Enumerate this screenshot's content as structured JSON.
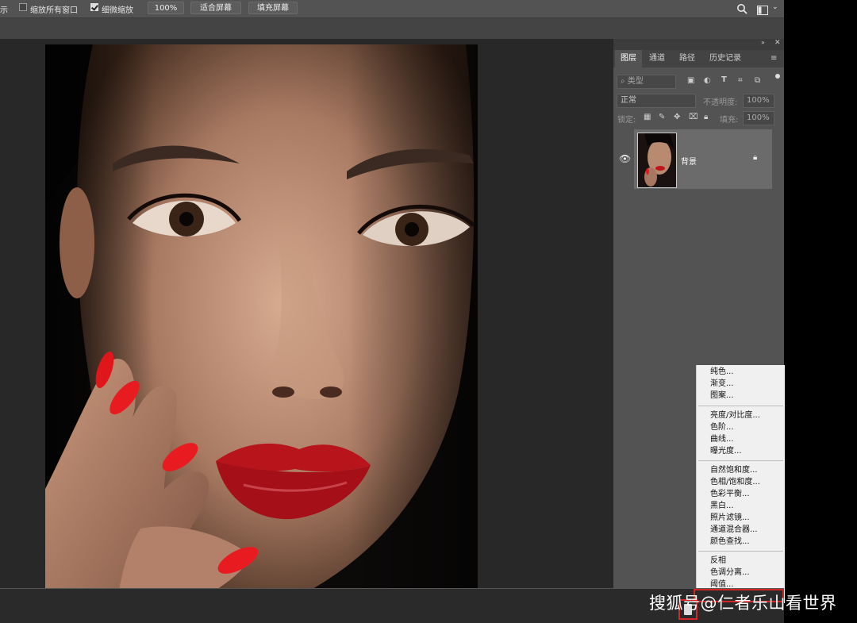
{
  "options_bar": {
    "left_fragment": "示",
    "resize_all_windows_label": "缩放所有窗口",
    "resize_all_windows_checked": false,
    "scrubby_zoom_label": "细微缩放",
    "scrubby_zoom_checked": true,
    "zoom_value": "100%",
    "fit_screen_label": "适合屏幕",
    "fill_screen_label": "填充屏幕"
  },
  "panel": {
    "tabs": [
      {
        "label": "图层",
        "active": true
      },
      {
        "label": "通道",
        "active": false
      },
      {
        "label": "路径",
        "active": false
      },
      {
        "label": "历史记录",
        "active": false
      }
    ],
    "filter_kind": "类型",
    "blend_mode": "正常",
    "opacity_label": "不透明度:",
    "opacity_value": "100%",
    "lock_label": "锁定:",
    "fill_label": "填充:",
    "fill_value": "100%",
    "layer": {
      "name": "背景",
      "visible": true,
      "locked": true
    }
  },
  "adjustment_menu": {
    "groups": [
      [
        "纯色...",
        "渐变...",
        "图案..."
      ],
      [
        "亮度/对比度...",
        "色阶...",
        "曲线...",
        "曝光度..."
      ],
      [
        "自然饱和度...",
        "色相/饱和度...",
        "色彩平衡...",
        "黑白...",
        "照片滤镜...",
        "通道混合器...",
        "颜色查找..."
      ],
      [
        "反相",
        "色调分离...",
        "阈值..."
      ]
    ]
  },
  "watermark": "搜狐号@仁者乐山看世界",
  "colors": {
    "highlight": "#d62626",
    "panel": "#535353",
    "canvas": "#282828"
  }
}
